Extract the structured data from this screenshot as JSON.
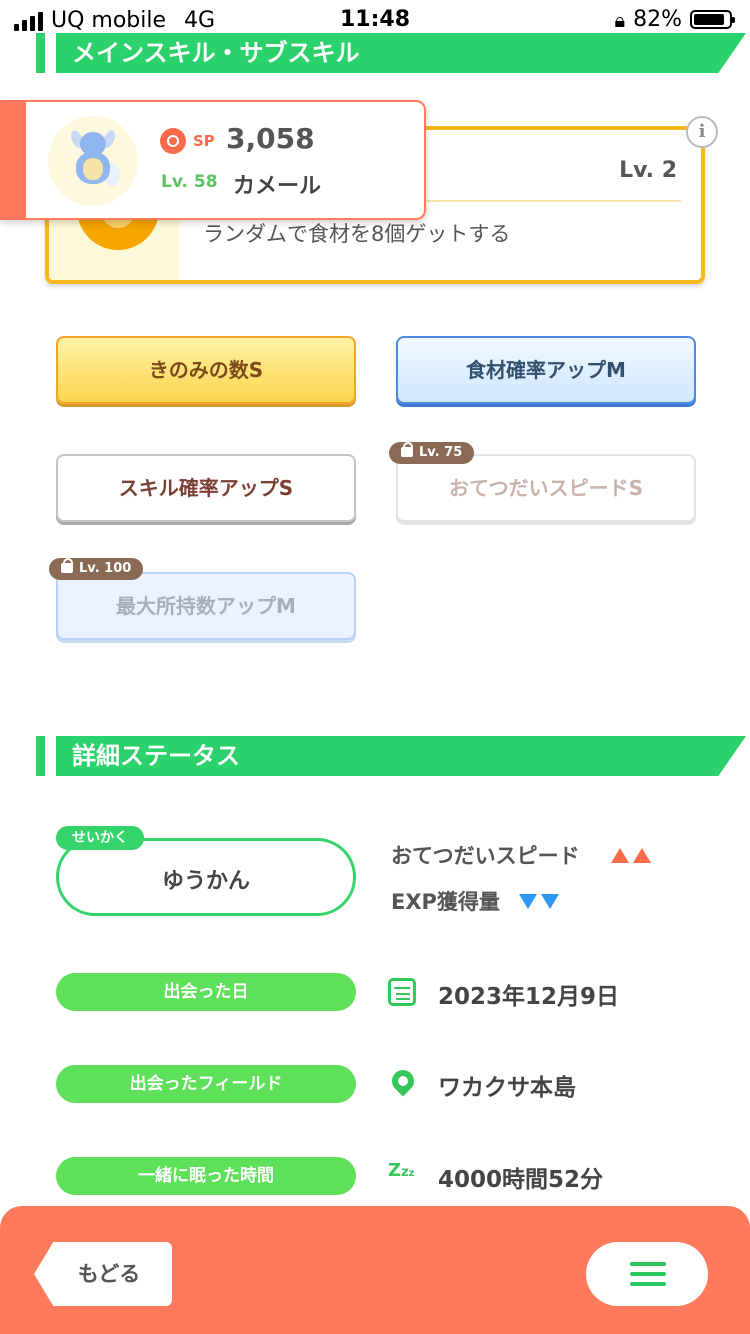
{
  "status_bar": {
    "carrier": "UQ mobile",
    "network": "4G",
    "time": "11:48",
    "battery": "82%"
  },
  "skills_section": {
    "title": "メインスキル・サブスキル"
  },
  "pokemon": {
    "sp_label": "SP",
    "sp_value": "3,058",
    "level_label": "Lv. 58",
    "name": "カメール"
  },
  "main_skill": {
    "level": "Lv. 2",
    "description": "ランダムで食材を8個ゲットする"
  },
  "sub_skills": [
    {
      "label": "きのみの数S",
      "style": "gold",
      "locked": false
    },
    {
      "label": "食材確率アップM",
      "style": "blue",
      "locked": false
    },
    {
      "label": "スキル確率アップS",
      "style": "white",
      "locked": false
    },
    {
      "label": "おてつだいスピードS",
      "style": "white-dim",
      "locked": true,
      "lock_level": "Lv. 75"
    },
    {
      "label": "最大所持数アップM",
      "style": "blue-dim",
      "locked": true,
      "lock_level": "Lv. 100"
    }
  ],
  "details_section": {
    "title": "詳細ステータス"
  },
  "nature": {
    "tag": "せいかく",
    "value": "ゆうかん",
    "up_effect": "おてつだいスピード",
    "down_effect": "EXP獲得量"
  },
  "info_rows": {
    "met_date_label": "出会った日",
    "met_date_value": "2023年12月9日",
    "met_field_label": "出会ったフィールド",
    "met_field_value": "ワカクサ本島",
    "sleep_time_label": "一緒に眠った時間",
    "sleep_time_value": "4000時間52分"
  },
  "bottom_nav": {
    "back_label": "もどる"
  },
  "colors": {
    "accent_green": "#2bd16a",
    "bottom_bar": "#ff7a5c",
    "up_arrow": "#ff6a48",
    "down_arrow": "#2e96f0"
  }
}
